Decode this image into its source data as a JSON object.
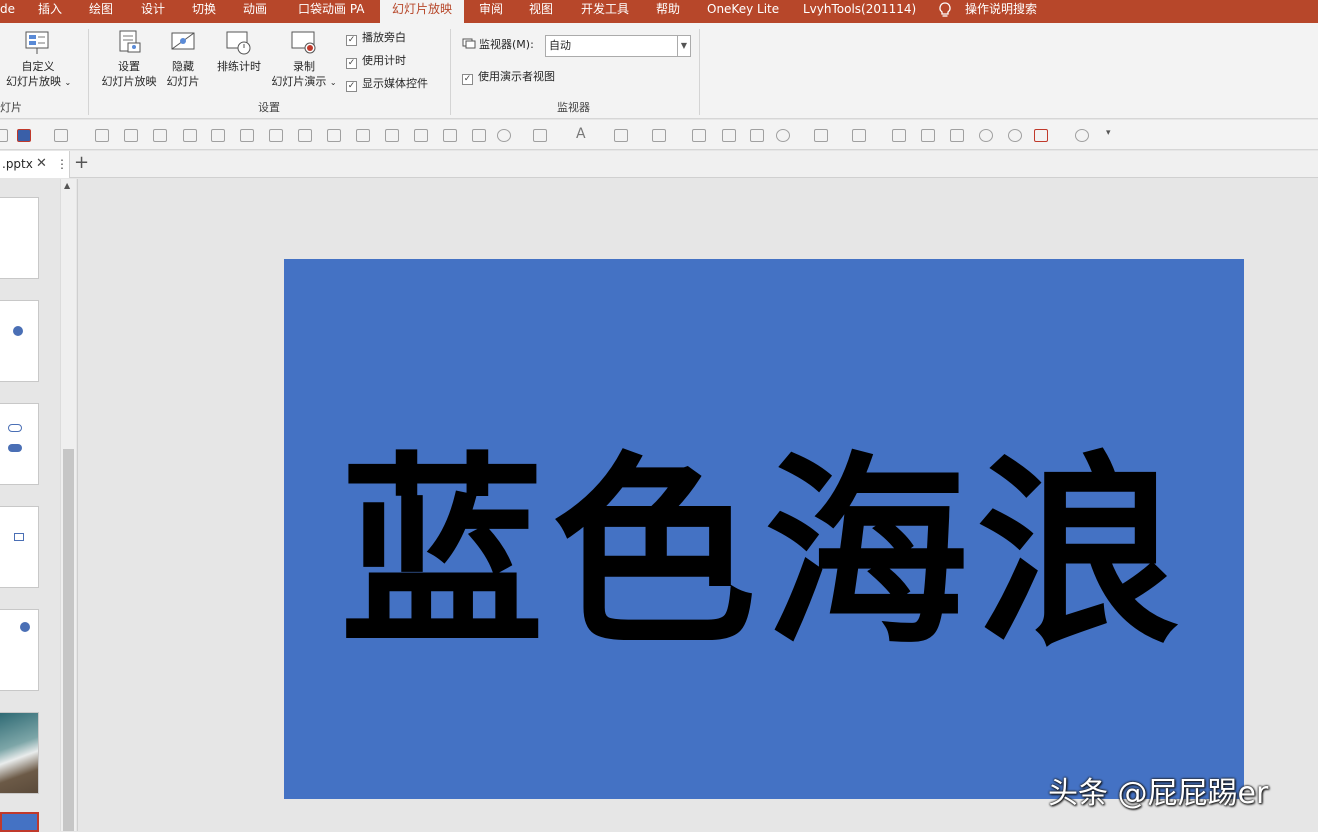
{
  "menu": {
    "tabs": [
      "de",
      "插入",
      "绘图",
      "设计",
      "切换",
      "动画",
      "口袋动画 PA",
      "幻灯片放映",
      "审阅",
      "视图",
      "开发工具",
      "帮助",
      "OneKey Lite",
      "LvyhTools(201114)"
    ],
    "active_tab": "幻灯片放映",
    "search": "操作说明搜索"
  },
  "ribbon": {
    "custom_show": {
      "line1": "自定义",
      "line2": "幻灯片放映"
    },
    "left_group_label_fragment": "灯片",
    "setup_show": {
      "line1": "设置",
      "line2": "幻灯片放映"
    },
    "hide_slide": {
      "line1": "隐藏",
      "line2": "幻灯片"
    },
    "rehearse": "排练计时",
    "record": {
      "line1": "录制",
      "line2": "幻灯片演示"
    },
    "checkboxes": {
      "narration": "播放旁白",
      "timings": "使用计时",
      "media_controls": "显示媒体控件"
    },
    "setup_group_label": "设置",
    "monitor_label": "监视器(M):",
    "monitor_value": "自动",
    "presenter_view": "使用演示者视图",
    "monitor_group_label": "监视器"
  },
  "document": {
    "tab_name": ".pptx"
  },
  "slide": {
    "title": "蓝色海浪",
    "background": "#4472c4"
  },
  "watermark": "头条 @屁屁踢er",
  "colors": {
    "accent": "#b7472a"
  }
}
